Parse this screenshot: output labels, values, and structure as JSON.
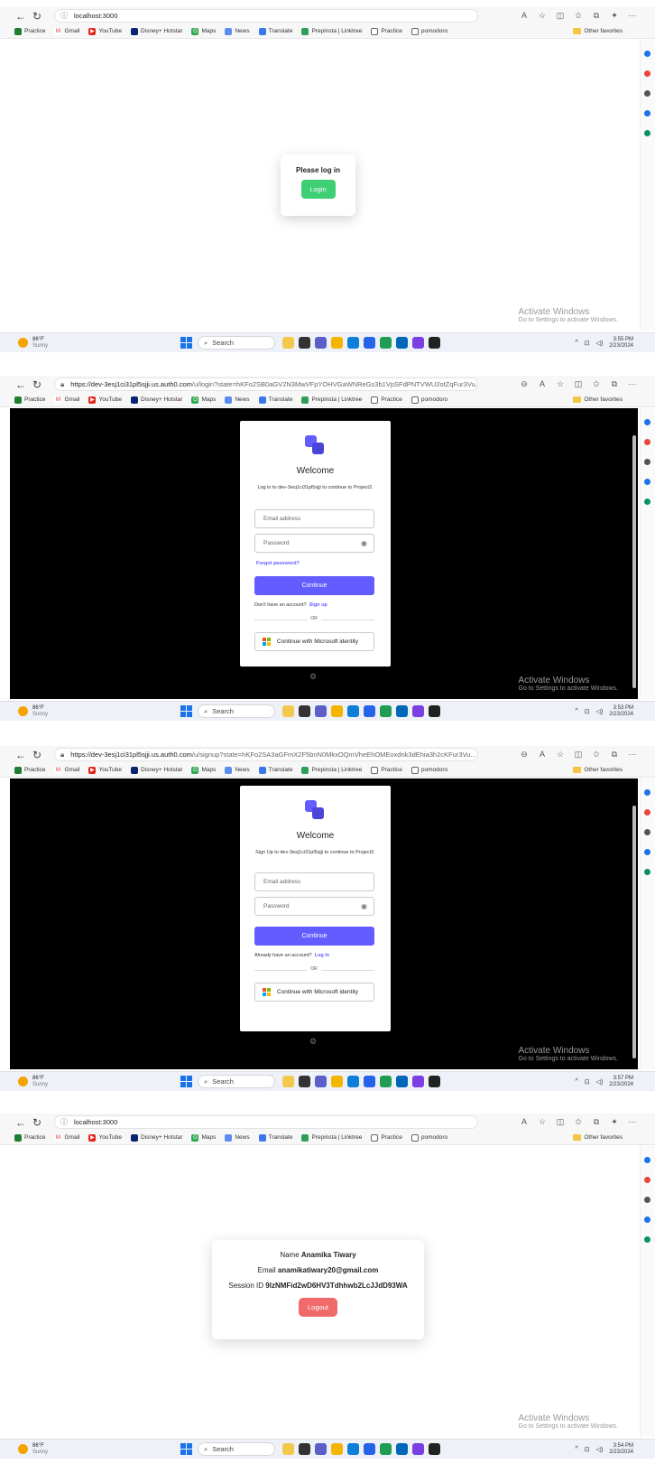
{
  "browser": {
    "bookmarks": [
      "Practice",
      "Gmail",
      "YouTube",
      "Disney+ Hotstar",
      "Maps",
      "News",
      "Translate",
      "Prepinsta | Linktree",
      "Practice",
      "pomodoro"
    ],
    "other_favorites": "Other favorites"
  },
  "system": {
    "weather_temp": "86°F",
    "weather_desc": "Sunny",
    "search_label": "Search",
    "activate_title": "Activate Windows",
    "activate_sub": "Go to Settings to activate Windows."
  },
  "screens": [
    {
      "url_host": "localhost:3000",
      "url_rest": "",
      "clock_time": "3:55 PM",
      "clock_date": "2/23/2024",
      "card_title": "Please log in",
      "login_button": "Login"
    },
    {
      "url_host": "https://dev-3esj1ci31pl5sjji.us.auth0.com",
      "url_rest": "/u/login?state=hKFo2SB0aGV2N3MwVFpYOHVGaWNReGs3b1VpSFdPNTVWU2otZqFur3Vu...",
      "clock_time": "3:53 PM",
      "clock_date": "2/23/2024",
      "welcome": "Welcome",
      "subtitle": "Log in to dev-3esj1ci31pl5sjji to continue to Project2.",
      "email_placeholder": "Email address",
      "password_placeholder": "Password",
      "forgot": "Forgot password?",
      "continue": "Continue",
      "account_prompt": "Don't have an account?",
      "account_link": "Sign up",
      "or": "OR",
      "microsoft": "Continue with Microsoft identity"
    },
    {
      "url_host": "https://dev-3esj1ci31pl5sjji.us.auth0.com",
      "url_rest": "/u/signup?state=hKFo2SA3aGFmX2F5bnN0MkxOQmVheEhOMEoxdnk3dEhia3h2cKFur3Vu...",
      "clock_time": "3:57 PM",
      "clock_date": "2/23/2024",
      "welcome": "Welcome",
      "subtitle": "Sign Up to dev-3esj1ci31pl5sjji to continue to Project2.",
      "email_placeholder": "Email address",
      "password_placeholder": "Password",
      "continue": "Continue",
      "account_prompt": "Already have an account?",
      "account_link": "Log in",
      "or": "OR",
      "microsoft": "Continue with Microsoft identity"
    },
    {
      "url_host": "localhost:3000",
      "url_rest": "",
      "clock_time": "3:54 PM",
      "clock_date": "2/23/2024",
      "name_label": "Name",
      "name_value": "Anamika Tiwary",
      "email_label": "Email",
      "email_value": "anamikatiwary20@gmail.com",
      "session_label": "Session ID",
      "session_value": "9lzNMFid2wD6HV3Tdhhwb2LcJJdD93WA",
      "logout_button": "Logout"
    }
  ]
}
